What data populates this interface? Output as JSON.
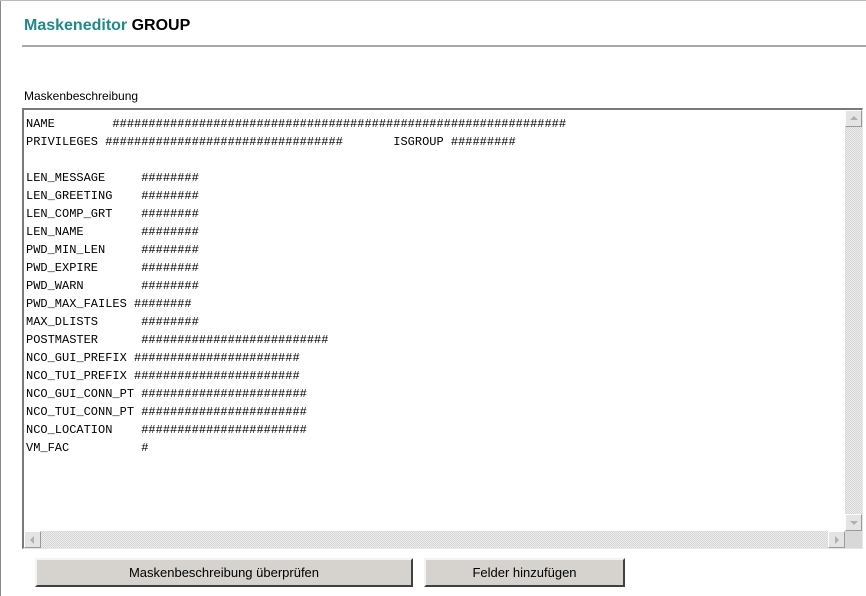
{
  "header": {
    "title_part1": "Maskeneditor",
    "title_part2": "GROUP"
  },
  "editor": {
    "label": "Maskenbeschreibung",
    "lines": [
      "NAME        ###############################################################",
      "PRIVILEGES #################################       ISGROUP #########",
      "",
      "LEN_MESSAGE     ########",
      "LEN_GREETING    ########",
      "LEN_COMP_GRT    ########",
      "LEN_NAME        ########",
      "PWD_MIN_LEN     ########",
      "PWD_EXPIRE      ########",
      "PWD_WARN        ########",
      "PWD_MAX_FAILES ########",
      "MAX_DLISTS      ########",
      "POSTMASTER      ##########################",
      "NCO_GUI_PREFIX #######################",
      "NCO_TUI_PREFIX #######################",
      "NCO_GUI_CONN_PT #######################",
      "NCO_TUI_CONN_PT #######################",
      "NCO_LOCATION    #######################",
      "VM_FAC          #"
    ]
  },
  "buttons": {
    "check_label": "Maskenbeschreibung überprüfen",
    "add_label": "Felder hinzufügen"
  },
  "colors": {
    "title_accent": "#1f8a8a",
    "button_face": "#d6d3ce"
  },
  "icons": {
    "scroll_up": "arrow-up-icon",
    "scroll_down": "arrow-down-icon",
    "scroll_left": "arrow-left-icon",
    "scroll_right": "arrow-right-icon"
  }
}
